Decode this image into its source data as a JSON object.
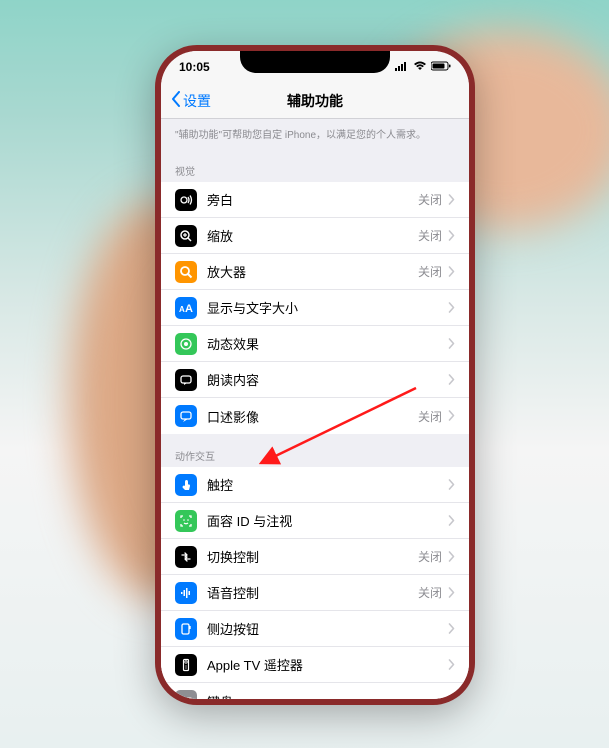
{
  "statusBar": {
    "time": "10:05",
    "signal": "••••",
    "wifi": "wifi",
    "battery": "85"
  },
  "nav": {
    "back": "设置",
    "title": "辅助功能"
  },
  "descriptor": "\"辅助功能\"可帮助您自定 iPhone，以满足您的个人需求。",
  "sections": {
    "visual": {
      "header": "视觉",
      "items": [
        {
          "label": "旁白",
          "status": "关闭",
          "iconBg": "#000000",
          "glyph": "voiceover"
        },
        {
          "label": "缩放",
          "status": "关闭",
          "iconBg": "#000000",
          "glyph": "zoom"
        },
        {
          "label": "放大器",
          "status": "关闭",
          "iconBg": "#ff9500",
          "glyph": "magnifier"
        },
        {
          "label": "显示与文字大小",
          "status": "",
          "iconBg": "#007aff",
          "glyph": "text"
        },
        {
          "label": "动态效果",
          "status": "",
          "iconBg": "#34c759",
          "glyph": "motion"
        },
        {
          "label": "朗读内容",
          "status": "",
          "iconBg": "#000000",
          "glyph": "speech"
        },
        {
          "label": "口述影像",
          "status": "关闭",
          "iconBg": "#007aff",
          "glyph": "audio-desc"
        }
      ]
    },
    "interaction": {
      "header": "动作交互",
      "items": [
        {
          "label": "触控",
          "status": "",
          "iconBg": "#007aff",
          "glyph": "touch"
        },
        {
          "label": "面容 ID 与注视",
          "status": "",
          "iconBg": "#34c759",
          "glyph": "faceid"
        },
        {
          "label": "切换控制",
          "status": "关闭",
          "iconBg": "#000000",
          "glyph": "switch"
        },
        {
          "label": "语音控制",
          "status": "关闭",
          "iconBg": "#007aff",
          "glyph": "voice"
        },
        {
          "label": "侧边按钮",
          "status": "",
          "iconBg": "#007aff",
          "glyph": "side-btn"
        },
        {
          "label": "Apple TV 遥控器",
          "status": "",
          "iconBg": "#000000",
          "glyph": "remote"
        },
        {
          "label": "键盘",
          "status": "",
          "iconBg": "#8e8e93",
          "glyph": "keyboard"
        }
      ]
    }
  },
  "statusOff": "关闭"
}
